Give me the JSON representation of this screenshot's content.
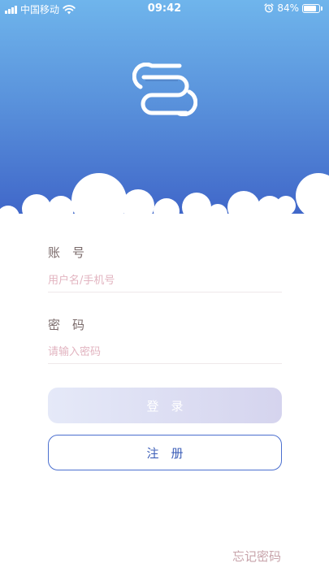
{
  "status_bar": {
    "carrier": "中国移动",
    "time": "09:42",
    "battery_percent_text": "84%",
    "battery_level": 0.84
  },
  "icons": {
    "logo": "app-logo-icon",
    "wifi": "wifi-icon",
    "alarm": "alarm-icon",
    "signal": "signal-icon",
    "battery": "battery-icon"
  },
  "colors": {
    "header_top": "#6fb5ec",
    "header_bottom": "#3f65c8",
    "accent": "#4b6fcf",
    "label": "#7a6a6a",
    "placeholder": "#e2b4c0"
  },
  "form": {
    "username": {
      "label": "账　号",
      "placeholder": "用户名/手机号",
      "value": ""
    },
    "password": {
      "label": "密　码",
      "placeholder": "请输入密码",
      "value": ""
    }
  },
  "buttons": {
    "login": "登　录",
    "register": "注　册"
  },
  "links": {
    "forgot_password": "忘记密码"
  }
}
